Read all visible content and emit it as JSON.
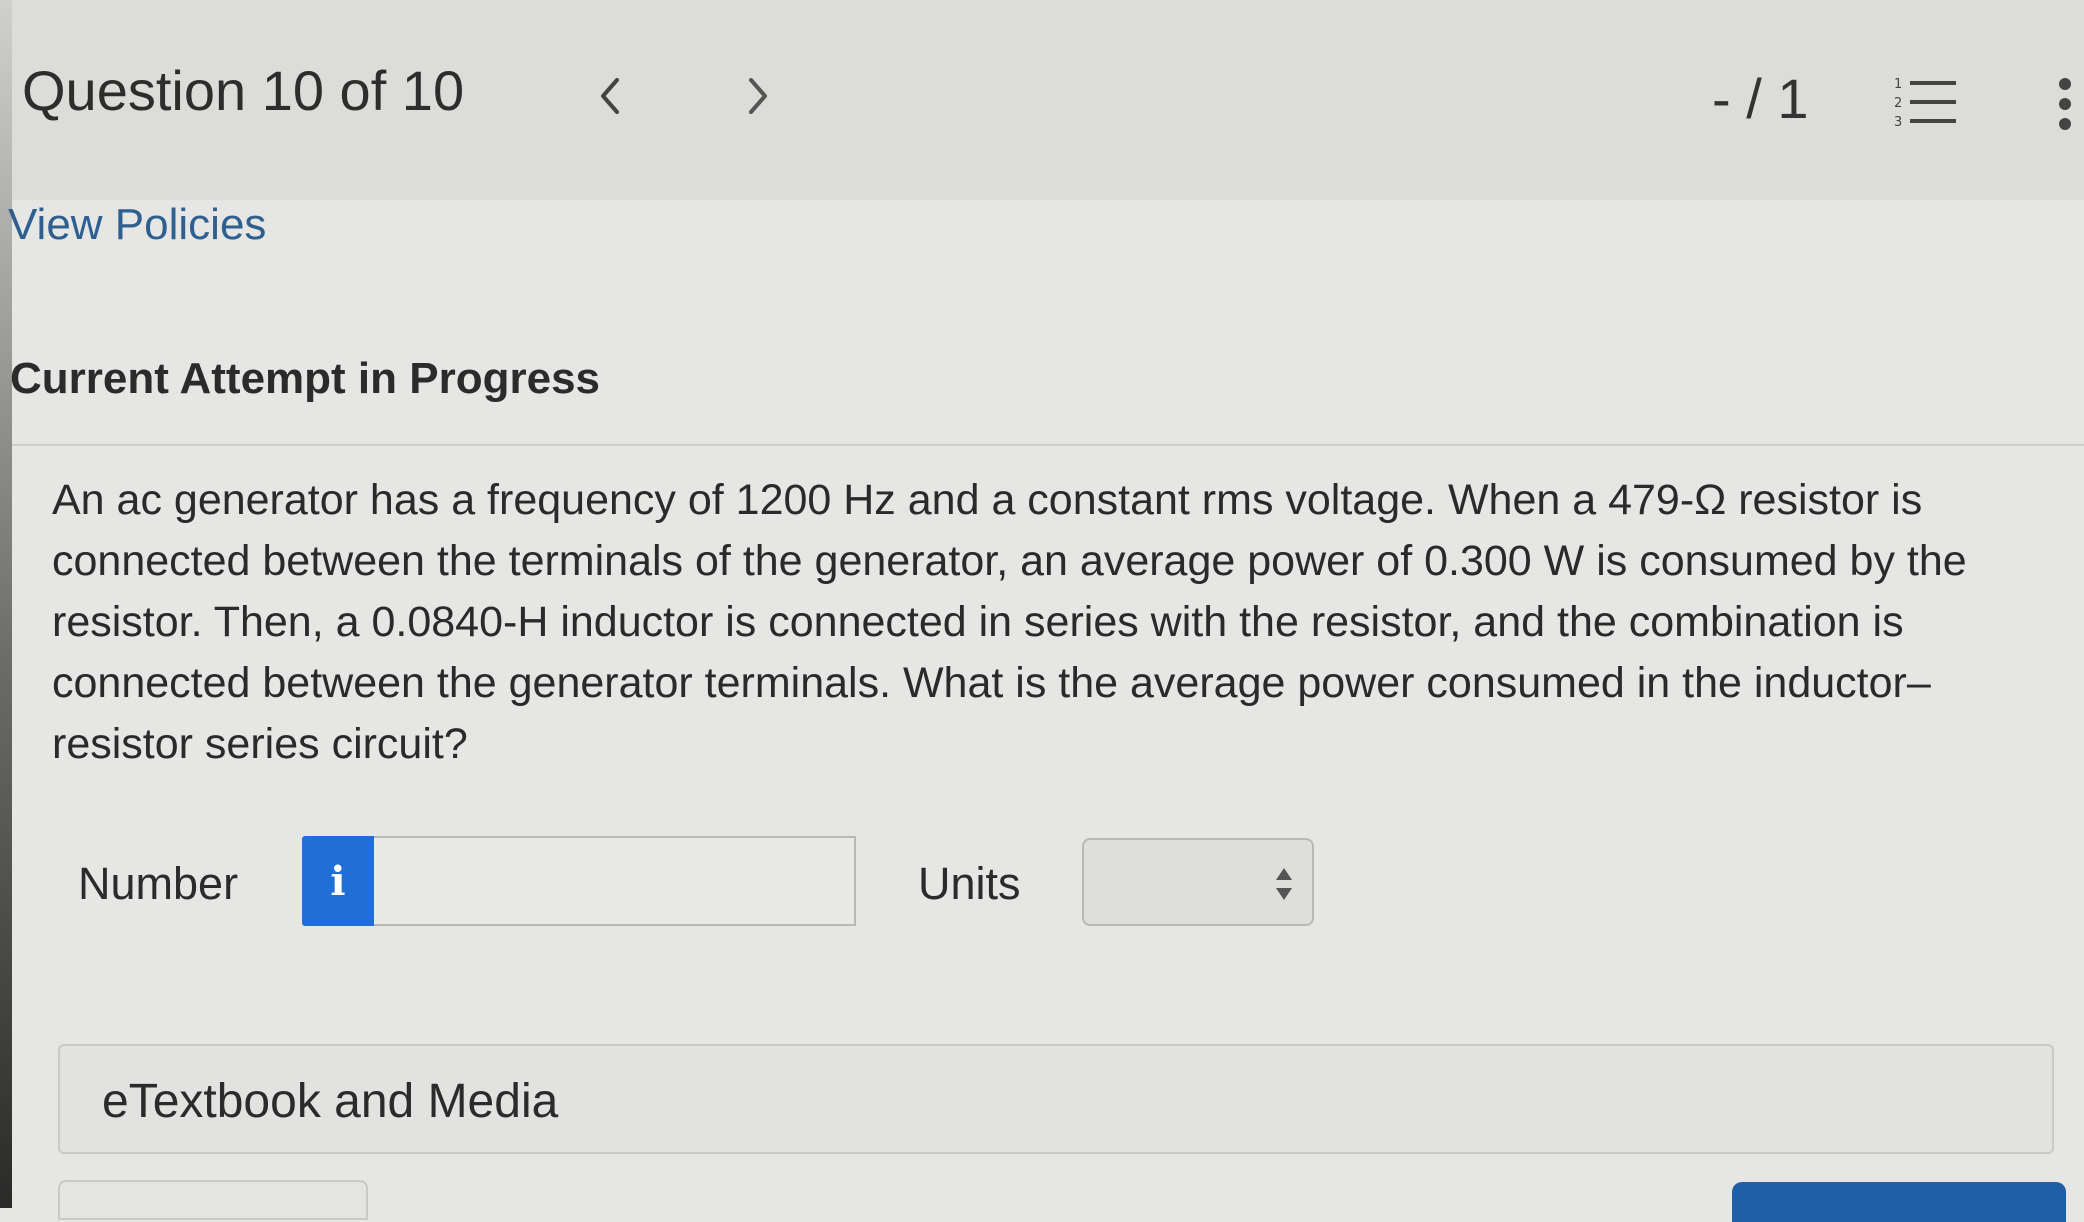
{
  "header": {
    "question_title": "Question 10 of 10",
    "score": "- / 1",
    "prev_icon": "chevron-left-icon",
    "next_icon": "chevron-right-icon",
    "list_icon": "numbered-list-icon",
    "more_icon": "vertical-dots-icon"
  },
  "links": {
    "view_policies": "View Policies"
  },
  "attempt": {
    "heading": "Current Attempt in Progress"
  },
  "question": {
    "text": "An ac generator has a frequency of 1200 Hz and a constant rms voltage. When a 479-Ω resistor is connected between the terminals of the generator, an average power of 0.300 W is consumed by the resistor. Then, a 0.0840-H inductor is connected in series with the resistor, and the combination is connected between the generator terminals. What is the average power consumed in the inductor–resistor series circuit?"
  },
  "answer": {
    "number_label": "Number",
    "info_icon_glyph": "i",
    "number_value": "",
    "units_label": "Units",
    "units_selected": ""
  },
  "resources": {
    "etextbook_label": "eTextbook and Media"
  },
  "colors": {
    "accent_blue": "#1f6fd6",
    "link_blue": "#2f5f8f",
    "background": "#e6e6e4"
  }
}
